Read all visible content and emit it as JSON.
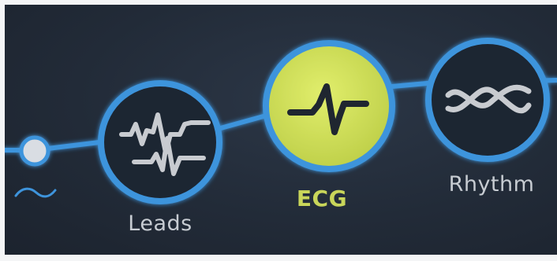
{
  "steps": [
    {
      "label": "",
      "icon": "tilde-icon",
      "state": "idle"
    },
    {
      "label": "Leads",
      "icon": "leads-waveform-icon",
      "state": "idle"
    },
    {
      "label": "ECG",
      "icon": "ecg-pulse-icon",
      "state": "active"
    },
    {
      "label": "Rhythm",
      "icon": "rhythm-crossing-icon",
      "state": "idle"
    }
  ],
  "colors": {
    "background": "#232c39",
    "ring": "#3b8fd6",
    "active_fill": "#d2e35c",
    "icon": "#c8cbd0",
    "active_text": "#c9d65a"
  }
}
